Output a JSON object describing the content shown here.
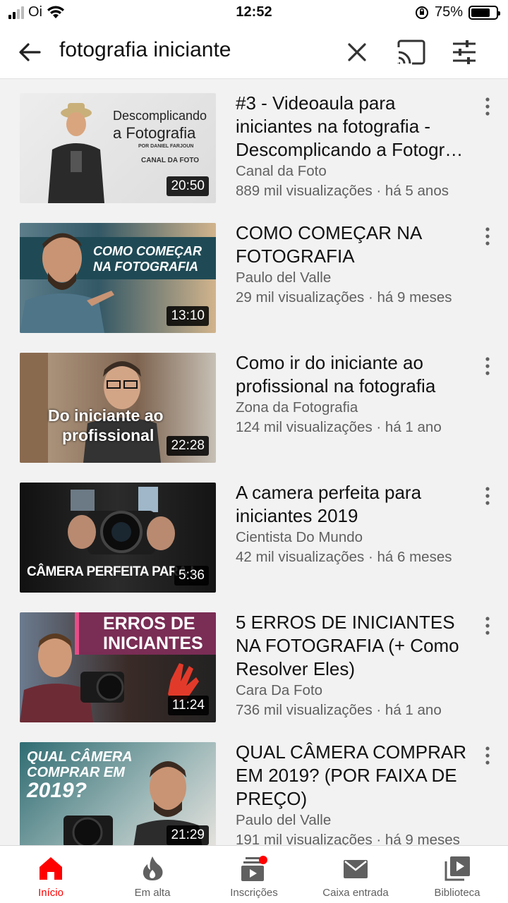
{
  "status": {
    "carrier": "Oi",
    "time": "12:52",
    "battery": "75%",
    "battery_level": 0.75
  },
  "search": {
    "query": "fotografia iniciante"
  },
  "colors": {
    "accent": "#ff0000",
    "meta_text": "#606060"
  },
  "videos": [
    {
      "title": "#3 - Videoaula  para iniciantes na fotografia - Descomplicando a Fotogr…",
      "channel": "Canal da Foto",
      "stats": "889 mil visualizações · há 5 anos",
      "duration": "20:50",
      "thumb_text": [
        "Descomplicando",
        "a Fotografia",
        "POR DANIEL FARJOUN",
        "CANAL DA FOTO"
      ]
    },
    {
      "title": "COMO COMEÇAR NA FOTOGRAFIA",
      "channel": "Paulo del Valle",
      "stats": "29 mil visualizações · há 9 meses",
      "duration": "13:10",
      "thumb_text": [
        "COMO COMEÇAR",
        "NA FOTOGRAFIA"
      ]
    },
    {
      "title": "Como ir do iniciante ao profissional na fotografia",
      "channel": "Zona da Fotografia",
      "stats": "124 mil visualizações · há 1 ano",
      "duration": "22:28",
      "thumb_text": [
        "Do iniciante ao",
        "profissional"
      ]
    },
    {
      "title": "A camera perfeita para iniciantes 2019",
      "channel": "Cientista Do Mundo",
      "stats": "42 mil visualizações · há 6 meses",
      "duration": "5:36",
      "thumb_text": [
        "CÂMERA PERFEITA PARA I"
      ]
    },
    {
      "title": "5 ERROS DE INICIANTES NA FOTOGRAFIA (+ Como Resolver Eles)",
      "channel": "Cara Da Foto",
      "stats": "736 mil visualizações · há 1 ano",
      "duration": "11:24",
      "thumb_text": [
        "ERROS DE",
        "INICIANTES"
      ]
    },
    {
      "title": "QUAL CÂMERA COMPRAR EM 2019? (POR FAIXA DE PREÇO)",
      "channel": "Paulo del Valle",
      "stats": "191 mil visualizações · há 9 meses",
      "duration": "21:29",
      "thumb_text": [
        "QUAL CÂMERA",
        "COMPRAR EM",
        "2019?"
      ]
    }
  ],
  "tabs": [
    {
      "label": "Início",
      "icon": "home-icon"
    },
    {
      "label": "Em alta",
      "icon": "trending-icon"
    },
    {
      "label": "Inscrições",
      "icon": "subscriptions-icon"
    },
    {
      "label": "Caixa entrada",
      "icon": "inbox-icon"
    },
    {
      "label": "Biblioteca",
      "icon": "library-icon"
    }
  ]
}
